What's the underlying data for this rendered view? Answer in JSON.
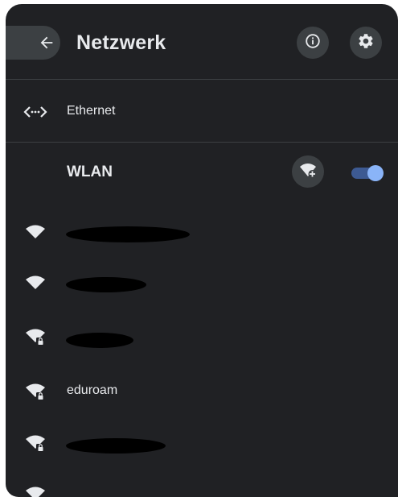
{
  "header": {
    "title": "Netzwerk",
    "back_icon": "arrow-left-icon",
    "info_icon": "info-icon",
    "settings_icon": "gear-icon"
  },
  "ethernet": {
    "label": "Ethernet",
    "icon": "ethernet-icon"
  },
  "wlan": {
    "label": "WLAN",
    "add_network_icon": "wifi-add-icon",
    "enabled": true
  },
  "networks": [
    {
      "name": "",
      "secured": false,
      "redacted": true
    },
    {
      "name": "",
      "secured": false,
      "redacted": true
    },
    {
      "name": "",
      "secured": true,
      "redacted": true
    },
    {
      "name": "eduroam",
      "secured": true,
      "redacted": false
    },
    {
      "name": "",
      "secured": true,
      "redacted": true
    },
    {
      "name": "",
      "secured": true,
      "redacted": false
    }
  ],
  "colors": {
    "panel_bg": "#202124",
    "button_bg": "#3c4043",
    "text": "#e8eaed",
    "toggle_track": "#3d5a92",
    "toggle_knob": "#8ab4f8"
  }
}
